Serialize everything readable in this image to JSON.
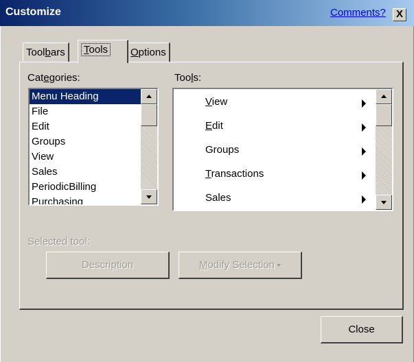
{
  "window": {
    "title": "Customize",
    "comments_link": "Comments?",
    "close_glyph": "X"
  },
  "tabs": [
    {
      "pre": "Tool",
      "ul": "b",
      "post": "ars",
      "active": false
    },
    {
      "pre": "",
      "ul": "T",
      "post": "ools",
      "active": true
    },
    {
      "pre": "",
      "ul": "O",
      "post": "ptions",
      "active": false
    }
  ],
  "categories": {
    "label_pre": "Cat",
    "label_ul": "e",
    "label_post": "gories:",
    "items": [
      "Menu Heading",
      "File",
      "Edit",
      "Groups",
      "View",
      "Sales",
      "PeriodicBilling",
      "Purchasing"
    ],
    "selected": "Menu Heading"
  },
  "tools": {
    "label_pre": "Too",
    "label_ul": "l",
    "label_post": "s:",
    "items": [
      {
        "pre": "",
        "ul": "V",
        "post": "iew"
      },
      {
        "pre": "",
        "ul": "E",
        "post": "dit"
      },
      {
        "pre": "Groups",
        "ul": "",
        "post": ""
      },
      {
        "pre": "",
        "ul": "T",
        "post": "ransactions"
      },
      {
        "pre": "Sales",
        "ul": "",
        "post": ""
      }
    ],
    "submenu_icon": "right-triangle"
  },
  "selected_tool": {
    "label": "Selected tool:",
    "description_pre": "Descri",
    "description_ul": "p",
    "description_post": "tion",
    "modify_pre": "",
    "modify_ul": "M",
    "modify_post": "odify Selection"
  },
  "footer": {
    "close_label": "Close"
  },
  "colors": {
    "dialog_bg": "#d4d0c8",
    "selection_bg": "#0a246a",
    "title_gradient_start": "#0a246a",
    "title_gradient_end": "#a6caf0",
    "disabled_text": "#a09d96"
  }
}
